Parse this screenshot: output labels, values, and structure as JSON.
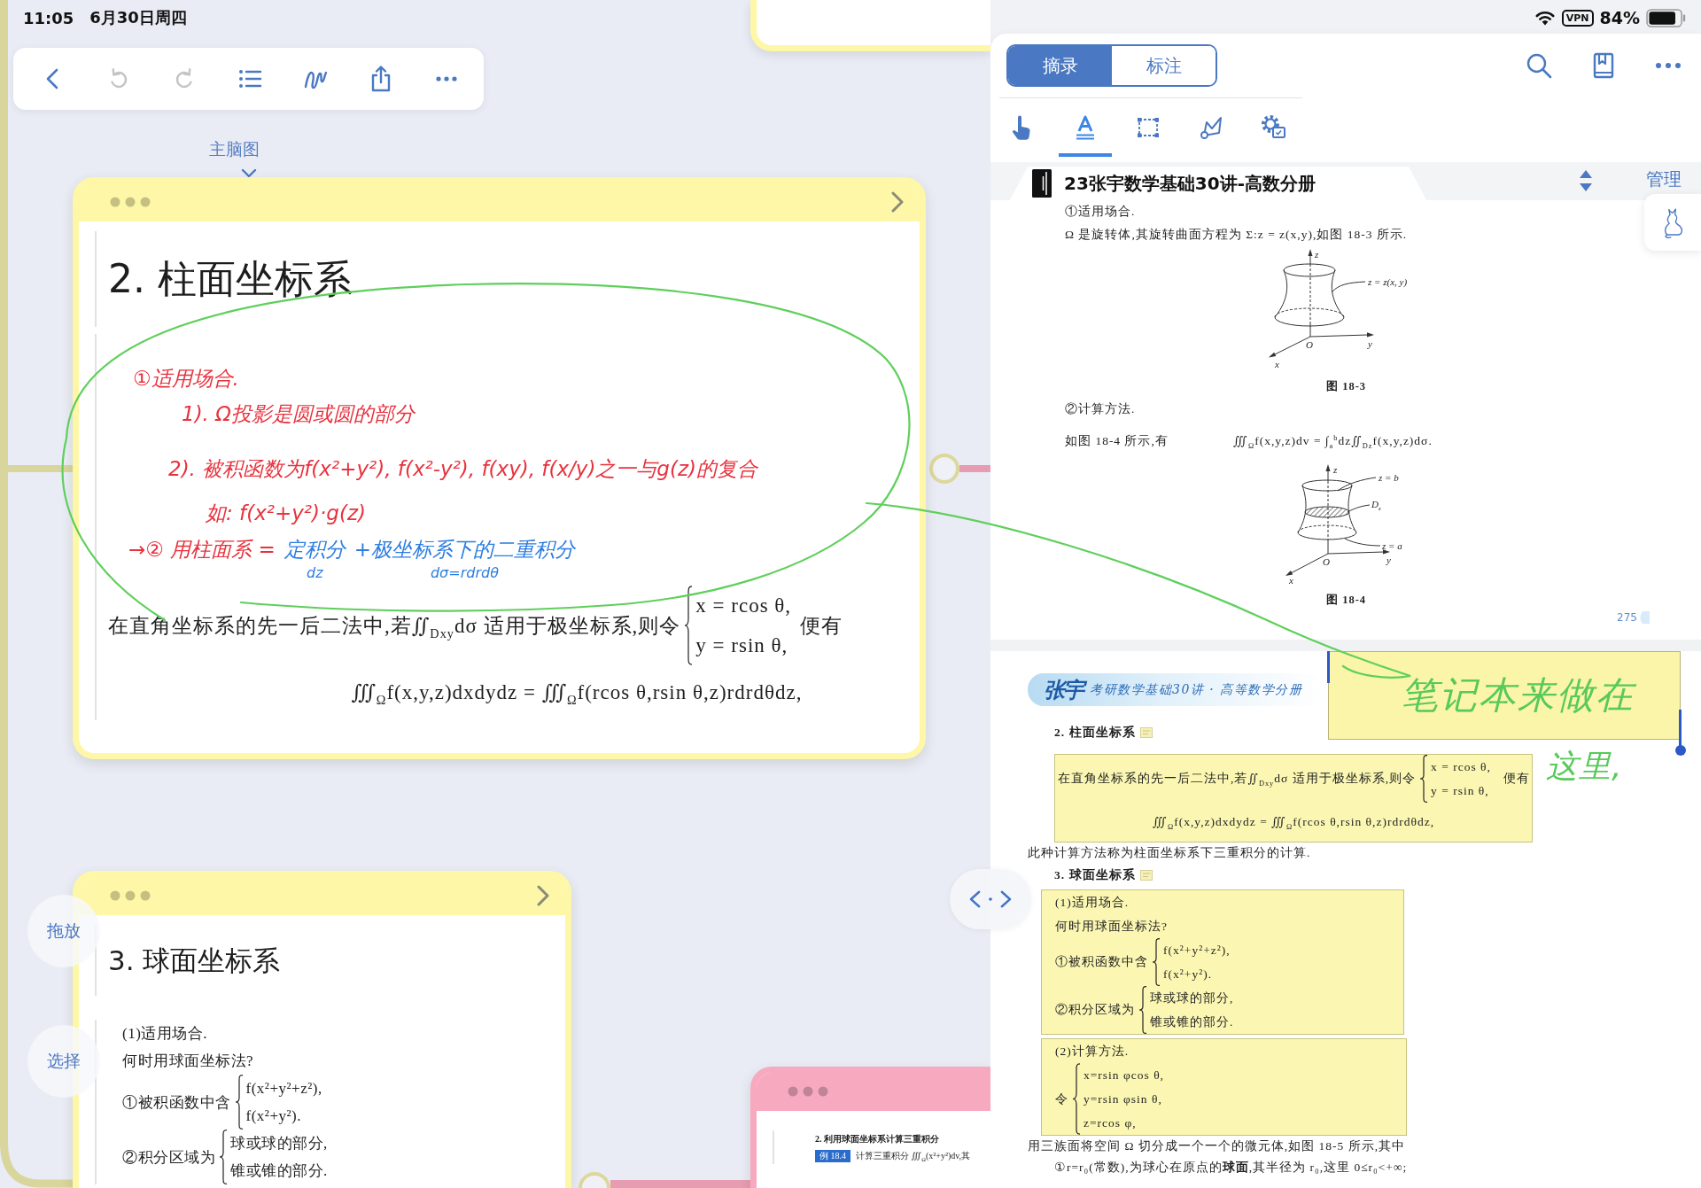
{
  "status_bar": {
    "time": "11:05",
    "date": "6月30日周四",
    "vpn": "VPN",
    "battery": "84%"
  },
  "toolbar": [
    {
      "kind": "back",
      "disabled": false
    },
    {
      "kind": "undo",
      "disabled": true
    },
    {
      "kind": "redo",
      "disabled": true
    },
    {
      "kind": "outline",
      "disabled": false
    },
    {
      "kind": "ink",
      "disabled": false
    },
    {
      "kind": "share",
      "disabled": false
    },
    {
      "kind": "more",
      "disabled": false
    }
  ],
  "mind_map": {
    "root_label": "主脑图",
    "side_buttons": [
      "拖放",
      "选择"
    ],
    "cards": [
      {
        "color": "#fdf7a7",
        "title": "2. 柱面坐标系",
        "ink": [
          {
            "parts": [
              {
                "text": "①适用场合.",
                "color": "#e8323e"
              }
            ]
          },
          {
            "parts": [
              {
                "text": "1). Ω投影是圆或圆的部分",
                "color": "#e8323e"
              }
            ]
          },
          {
            "parts": [
              {
                "text": "2). 被积函数为f(x²+y²), f(x²-y²), f(xy), f(x/y)之一与g(z)的复合",
                "color": "#e8323e"
              }
            ]
          },
          {
            "parts": [
              {
                "text": "如: f(x²+y²)·g(z)",
                "color": "#e8323e"
              }
            ]
          },
          {
            "parts": [
              {
                "text": "→② 用柱面系 =",
                "color": "#e8323e"
              },
              {
                "text": "定积分",
                "color": "#2e7de0",
                "note": "dz"
              },
              {
                "text": "+极坐标系下的二重积分",
                "color": "#2e7de0",
                "note": "dσ=rdrdθ"
              }
            ]
          }
        ],
        "blocks": [
          {
            "kind": "cases",
            "lead": "在直角坐标系的先一后二法中,若∬$_{Dxy}$dσ 适用于极坐标系,则令",
            "lines": [
              "x = rcos θ,",
              "y = rsin θ,"
            ],
            "tail": "便有"
          },
          {
            "kind": "formula",
            "text": "∭$_{Ω}$f(x,y,z)dxdydz = ∭$_{Ω}$f(rcos θ,rsin θ,z)rdrdθdz,"
          }
        ]
      },
      {
        "color": "#fdf7a7",
        "title": "3. 球面坐标系",
        "blocks": [
          {
            "kind": "para",
            "text": "(1)适用场合."
          },
          {
            "kind": "para",
            "text": "何时用球面坐标法?"
          },
          {
            "kind": "cases",
            "lead": "①被积函数中含",
            "lines": [
              "f(x²+y²+z²),",
              "f(x²+y²)."
            ]
          },
          {
            "kind": "cases",
            "lead": "②积分区域为",
            "lines": [
              "球或球的部分,",
              "锥或锥的部分."
            ]
          }
        ]
      },
      {
        "color": "#f7a9c0",
        "blocks": [
          {
            "kind": "heading",
            "text": "2. 利用球面坐标系计算三重积分",
            "note": false
          },
          {
            "kind": "example",
            "badge": "例 18.4",
            "text": "计算三重积分 ∭$_{Ω}$(x²+y²)dv,其"
          }
        ]
      }
    ]
  },
  "reader": {
    "segments": [
      {
        "label": "摘录",
        "selected": true
      },
      {
        "label": "标注",
        "selected": false
      }
    ],
    "actions": [
      {
        "kind": "search"
      },
      {
        "kind": "bookmark"
      },
      {
        "kind": "more"
      }
    ],
    "tools": [
      {
        "kind": "hand",
        "selected": false
      },
      {
        "kind": "text",
        "selected": true
      },
      {
        "kind": "frame",
        "selected": false
      },
      {
        "kind": "lasso",
        "selected": false
      },
      {
        "kind": "settings",
        "selected": false
      }
    ],
    "document": {
      "title": "23张宇数学基础30讲-高数分册",
      "manage": "管理"
    },
    "pages": [
      {
        "blocks": [
          {
            "kind": "para",
            "text": "①适用场合."
          },
          {
            "kind": "para",
            "text": "Ω 是旋转体,其旋转曲面方程为 Σ:z = z(x,y),如图 18-3 所示."
          },
          {
            "kind": "surface",
            "labels": [
              "z",
              "z = z(x, y)",
              "O",
              "y",
              "x"
            ],
            "caption": "图 18-3"
          },
          {
            "kind": "para",
            "text": "②计算方法."
          },
          {
            "kind": "equation",
            "lead": "如图 18-4 所示,有",
            "text": "∭$_{Ω}$f(x,y,z)dv = ∫$_{a}$$^{b}$dz∬$_{Dz}$f(x,y,z)dσ."
          },
          {
            "kind": "slice",
            "labels": [
              "z",
              "z = b",
              "D$_{z}$",
              "z = a",
              "O",
              "y",
              "x"
            ],
            "caption": "图 18-4"
          }
        ],
        "page_number": "275"
      },
      {
        "banner": {
          "logo": "张宇",
          "title": "考研数学基础30讲 · 高等数学分册"
        },
        "sticky_note": "笔记本来做在",
        "ink_note": "这里,",
        "blocks": [
          {
            "kind": "heading",
            "text": "2. 柱面坐标系",
            "note": true
          },
          {
            "kind": "box",
            "blocks": [
              {
                "kind": "cases",
                "lead": "在直角坐标系的先一后二法中,若∬$_{Dxy}$dσ 适用于极坐标系,则令",
                "lines": [
                  "x = rcos θ,",
                  "y = rsin θ,"
                ],
                "tail": "便有"
              },
              {
                "kind": "formula",
                "text": "∭$_{Ω}$f(x,y,z)dxdydz = ∭$_{Ω}$f(rcos θ,rsin θ,z)rdrdθdz,"
              }
            ]
          },
          {
            "kind": "para",
            "text": "此种计算方法称为柱面坐标系下三重积分的计算."
          },
          {
            "kind": "heading",
            "text": "3. 球面坐标系",
            "note": true
          },
          {
            "kind": "box",
            "blocks": [
              {
                "kind": "para",
                "text": "(1)适用场合."
              },
              {
                "kind": "para",
                "text": "何时用球面坐标法?"
              },
              {
                "kind": "cases",
                "lead": "①被积函数中含",
                "lines": [
                  "f(x²+y²+z²),",
                  "f(x²+y²)."
                ]
              },
              {
                "kind": "cases",
                "lead": "②积分区域为",
                "lines": [
                  "球或球的部分,",
                  "锥或锥的部分."
                ]
              }
            ]
          },
          {
            "kind": "box",
            "blocks": [
              {
                "kind": "para",
                "text": "(2)计算方法."
              },
              {
                "kind": "cases",
                "lead": "令",
                "lines": [
                  "x=rsin φcos θ,",
                  "y=rsin φsin θ,",
                  "z=rcos φ,"
                ]
              }
            ]
          },
          {
            "kind": "para",
            "text": "用三族面将空间 Ω 切分成一个一个的微元体,如图 18-5 所示,其中"
          },
          {
            "kind": "item",
            "text": "①r=r₀(常数),为球心在原点的**球面**,其半径为 r₀,这里 0≤r₀<+∞;"
          }
        ]
      }
    ]
  }
}
